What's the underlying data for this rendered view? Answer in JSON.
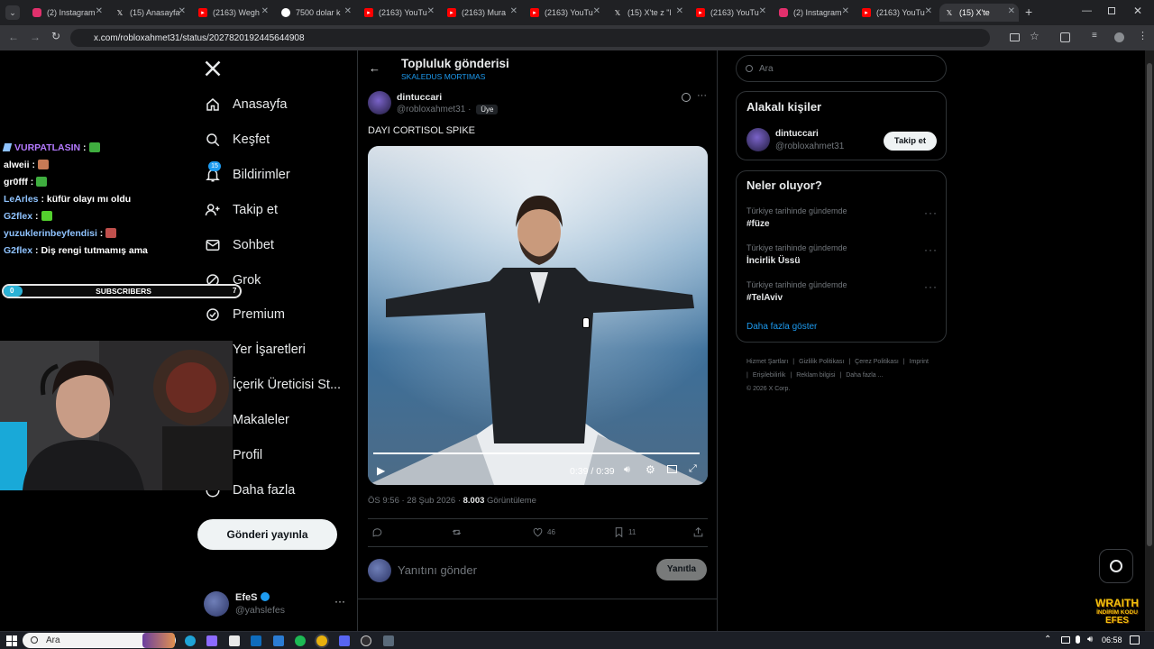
{
  "browser": {
    "tabs": [
      {
        "title": "(2) Instagram",
        "icon": "instagram-icon",
        "color": "#e1306c"
      },
      {
        "title": "(15) Anasayfa",
        "icon": "x-icon",
        "color": "#ffffff"
      },
      {
        "title": "(2163) Wegh",
        "icon": "youtube-icon",
        "color": "#ff0000"
      },
      {
        "title": "7500 dolar k",
        "icon": "chatgpt-icon",
        "color": "#ffffff"
      },
      {
        "title": "(2163) YouTu",
        "icon": "youtube-icon",
        "color": "#ff0000"
      },
      {
        "title": "(2163) Mura",
        "icon": "youtube-icon",
        "color": "#ff0000"
      },
      {
        "title": "(2163) YouTu",
        "icon": "youtube-icon",
        "color": "#ff0000"
      },
      {
        "title": "(15) X'te z \"l",
        "icon": "x-icon",
        "color": "#ffffff"
      },
      {
        "title": "(2163) YouTu",
        "icon": "youtube-icon",
        "color": "#ff0000"
      },
      {
        "title": "(2) Instagram",
        "icon": "instagram-icon",
        "color": "#e1306c"
      },
      {
        "title": "(2163) YouTu",
        "icon": "youtube-icon",
        "color": "#ff0000"
      },
      {
        "title": "(15) X'te",
        "icon": "x-icon",
        "color": "#ffffff"
      }
    ],
    "url": "x.com/robloxahmet31/status/2027820192445644908"
  },
  "nav": {
    "items": [
      {
        "label": "Anasayfa",
        "icon": "home-icon"
      },
      {
        "label": "Keşfet",
        "icon": "search-icon"
      },
      {
        "label": "Bildirimler",
        "icon": "bell-icon",
        "badge": "15"
      },
      {
        "label": "Takip et",
        "icon": "follow-icon"
      },
      {
        "label": "Sohbet",
        "icon": "mail-icon"
      },
      {
        "label": "Grok",
        "icon": "grok-icon"
      },
      {
        "label": "Premium",
        "icon": "premium-icon"
      },
      {
        "label": "Yer İşaretleri",
        "icon": "bookmark-icon"
      },
      {
        "label": "İçerik Üreticisi St...",
        "icon": "creator-icon"
      },
      {
        "label": "Makaleler",
        "icon": "article-icon"
      },
      {
        "label": "Profil",
        "icon": "profile-icon"
      },
      {
        "label": "Daha fazla",
        "icon": "more-icon"
      }
    ],
    "post_button": "Gönderi yayınla",
    "account": {
      "name": "EfeS",
      "handle": "@yahslefes"
    }
  },
  "chat": {
    "lines": [
      {
        "user": "VURPATLASIN",
        "sep": " :",
        "text": "",
        "color": "#b57bff",
        "emote": "#3fae3f"
      },
      {
        "user": "alweii",
        "sep": " :",
        "text": "",
        "color": "#ffffff",
        "emote": "#c77a55"
      },
      {
        "user": "gr0fff",
        "sep": " :",
        "text": "",
        "color": "#ffffff",
        "emote": "#3fae3f"
      },
      {
        "user": "LeArles",
        "sep": " :",
        "text": " küfür olayı mı oldu",
        "color": "#8fc3ff",
        "emote": ""
      },
      {
        "user": "G2flex",
        "sep": " :",
        "text": "",
        "color": "#8fc3ff",
        "emote": "#53d02e"
      },
      {
        "user": "yuzuklerinbeyfendisi",
        "sep": " :",
        "text": "",
        "color": "#8fc3ff",
        "emote": "#c0504d"
      },
      {
        "user": "G2flex",
        "sep": " :",
        "text": " Diş rengi tutmamış ama",
        "color": "#8fc3ff",
        "emote": ""
      }
    ],
    "subs_label": "SUBSCRIBERS",
    "subs_start": "0",
    "subs_goal": "7",
    "subs_progress": 0.03
  },
  "post": {
    "header_title": "Topluluk gönderisi",
    "header_subtitle": "SKALEDUS MORTIMAS",
    "author_name": "dintuccari",
    "author_handle": "@robloxahmet31",
    "dot": "·",
    "member_badge": "Üye",
    "text": "DAYI CORTISOL SPIKE",
    "video_time": "0:39 / 0:39",
    "video_progress": 1.0,
    "timestamp": "ÖS 9:56 · 28 Şub 2026 · ",
    "views_count": "8.003",
    "views_label": " Görüntüleme",
    "likes": "46",
    "bookmarks": "11",
    "reply_placeholder": "Yanıtını gönder",
    "reply_button": "Yanıtla"
  },
  "right": {
    "search_placeholder": "Ara",
    "related_title": "Alakalı kişiler",
    "related_name": "dintuccari",
    "related_handle": "@robloxahmet31",
    "follow_button": "Takip et",
    "trends_title": "Neler oluyor?",
    "trends": [
      {
        "context": "Türkiye tarihinde gündemde",
        "name": "#füze"
      },
      {
        "context": "Türkiye tarihinde gündemde",
        "name": "İncirlik Üssü"
      },
      {
        "context": "Türkiye tarihinde gündemde",
        "name": "#TelAviv"
      }
    ],
    "show_more": "Daha fazla göster",
    "footer_links": [
      "Hizmet Şartları",
      "|",
      "Gizlilik Politikası",
      "|",
      "Çerez Politikası",
      "|",
      "Imprint",
      "|",
      "Erişilebilirlik",
      "|",
      "Reklam bilgisi",
      "|",
      "Daha fazla ...",
      "© 2026 X Corp."
    ]
  },
  "overlay": {
    "brand_line1": "WRAITH",
    "brand_line2": "İNDİRİM KODU",
    "brand_line3": "EFES"
  },
  "taskbar": {
    "search": "Ara",
    "time": "06:58"
  },
  "colors": {
    "accent": "#1d9bf0",
    "background": "#000000",
    "border": "#2f3336",
    "muted": "#71767b"
  }
}
